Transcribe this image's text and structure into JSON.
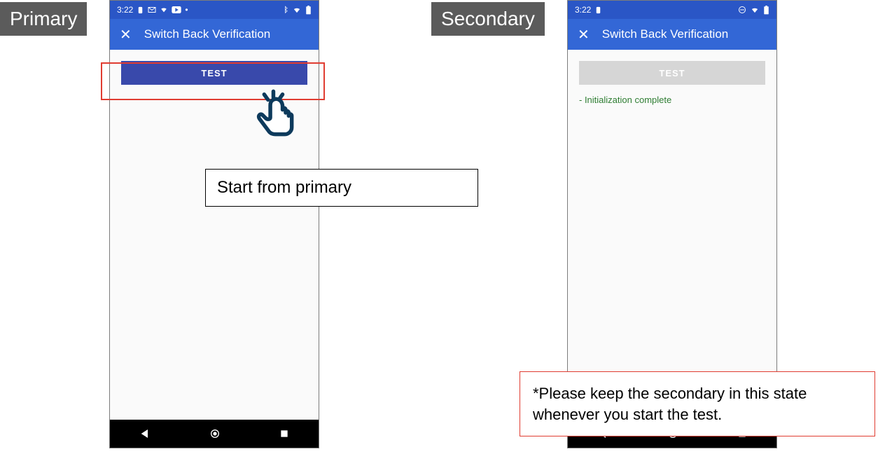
{
  "labels": {
    "primary": "Primary",
    "secondary": "Secondary"
  },
  "primary": {
    "status": {
      "time": "3:22"
    },
    "appbar": {
      "title": "Switch Back Verification"
    },
    "button": {
      "label": "TEST"
    }
  },
  "secondary": {
    "status": {
      "time": "3:22"
    },
    "appbar": {
      "title": "Switch Back Verification"
    },
    "button": {
      "label": "TEST"
    },
    "status_text": "- Initialization complete"
  },
  "annotations": {
    "start": "Start from primary",
    "note": "*Please keep the secondary in this state whenever you start the test."
  }
}
